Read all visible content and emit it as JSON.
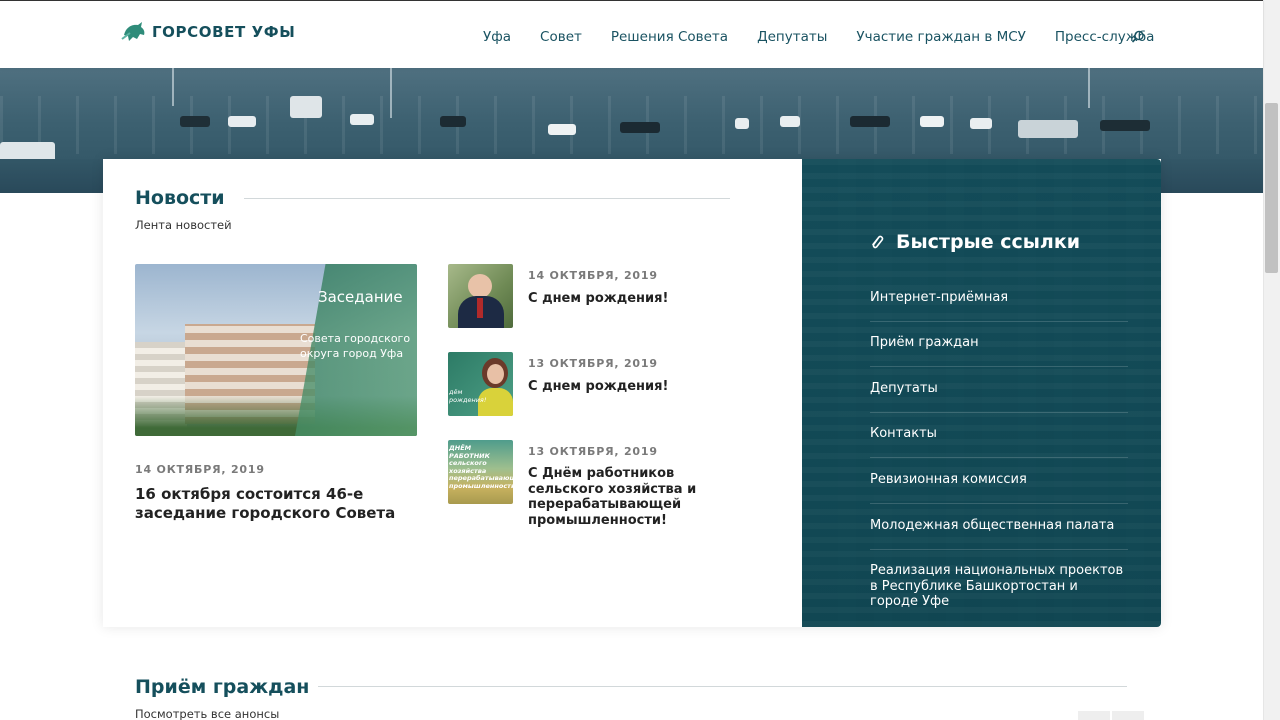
{
  "header": {
    "logo_text": "ГОРСОВЕТ УФЫ",
    "nav": [
      "Уфа",
      "Совет",
      "Решения Совета",
      "Депутаты",
      "Участие граждан в МСУ",
      "Пресс-служба"
    ],
    "search_icon": "search-icon"
  },
  "news": {
    "title": "Новости",
    "subtitle": "Лента новостей",
    "feature": {
      "image_title": "Заседание",
      "image_text": "Совета городского округа город Уфа",
      "date": "14 ОКТЯБРЯ, 2019",
      "title": "16 октября состоится 46-е заседание городского Совета"
    },
    "items": [
      {
        "date": "14 ОКТЯБРЯ, 2019",
        "title": "С днем рождения!"
      },
      {
        "date": "13 ОКТЯБРЯ, 2019",
        "title": "С днем рождения!",
        "thumb_text": "дём рождения!"
      },
      {
        "date": "13 ОКТЯБРЯ, 2019",
        "title": "С Днём работников сельского хозяйства и перерабатывающей промышленности!",
        "thumb_text": "ДНЁМ РАБОТНИК сельского хозяйства перерабатывающей промышленности"
      }
    ]
  },
  "quick_links": {
    "title": "Быстрые ссылки",
    "items": [
      "Интернет-приёмная",
      "Приём граждан",
      "Депутаты",
      "Контакты",
      "Ревизионная комиссия",
      "Молодежная общественная палата",
      "Реализация национальных проектов в Республике Башкортостан и городе Уфе"
    ]
  },
  "reception": {
    "title": "Приём граждан",
    "subtitle": "Посмотреть все анонсы"
  },
  "colors": {
    "brand": "#154f5c",
    "panel": "#124b58",
    "accent_green": "#2b7656"
  }
}
